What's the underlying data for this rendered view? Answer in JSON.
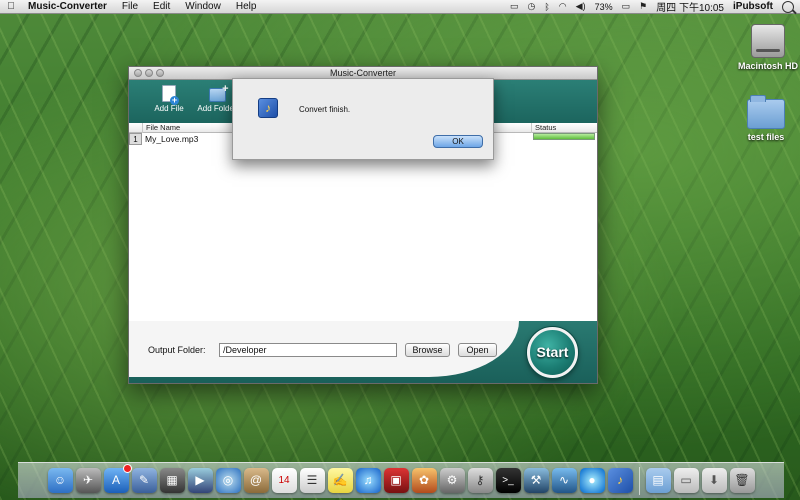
{
  "menubar": {
    "app_name": "Music-Converter",
    "items": [
      "File",
      "Edit",
      "Window",
      "Help"
    ],
    "battery": "73%",
    "clock": "周四 下午10:05",
    "user": "iPubsoft"
  },
  "desktop": {
    "icons": [
      {
        "label": "Macintosh HD"
      },
      {
        "label": "test files"
      }
    ]
  },
  "window": {
    "title": "Music-Converter",
    "toolbar": {
      "add_file": "Add File",
      "add_folder": "Add Folder"
    },
    "list": {
      "columns": {
        "file_name": "File Name",
        "status": "Status"
      },
      "rows": [
        {
          "index": "1",
          "file_name": "My_Love.mp3",
          "progress_percent": 100
        }
      ]
    },
    "output": {
      "label": "Output Folder:",
      "value": "/Developer",
      "browse": "Browse",
      "open": "Open"
    },
    "start": "Start"
  },
  "alert": {
    "message": "Convert finish.",
    "ok": "OK"
  },
  "colors": {
    "window_teal": "#1f6e66",
    "progress_green": "#5fbf3c",
    "ok_blue": "#6ea6e6"
  }
}
